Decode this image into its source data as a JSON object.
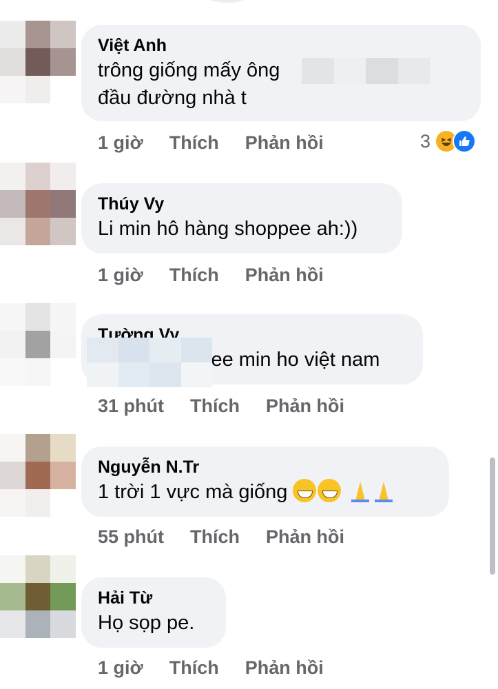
{
  "comments": [
    {
      "author": "Việt Anh",
      "text_lines": [
        "trông giống mấy ông",
        "đầu đường nhà t"
      ],
      "time": "1 giờ",
      "like_label": "Thích",
      "reply_label": "Phản hồi",
      "reaction_count": "3",
      "reaction_icons": [
        "haha-icon",
        "like-icon"
      ]
    },
    {
      "author": "Thúy Vy",
      "text_lines": [
        "Li min hô hàng shoppee ah:))"
      ],
      "time": "1 giờ",
      "like_label": "Thích",
      "reply_label": "Phản hồi"
    },
    {
      "author": "Tường Vy",
      "text_lines": [
        "lee min ho việt nam"
      ],
      "time": "31 phút",
      "like_label": "Thích",
      "reply_label": "Phản hồi"
    },
    {
      "author": "Nguyễn N.Tr",
      "text_lines": [
        "1 trời 1 vực mà giống"
      ],
      "emoji": [
        "😅",
        "😅",
        "🙏",
        "🙏"
      ],
      "time": "55 phút",
      "like_label": "Thích",
      "reply_label": "Phản hồi"
    },
    {
      "author": "Hải Từ",
      "text_lines": [
        "Họ sọp pe."
      ],
      "time": "1 giờ",
      "like_label": "Thích",
      "reply_label": "Phản hồi"
    }
  ],
  "colors": {
    "bubble": "#f0f2f5",
    "meta_text": "#65676b",
    "like_blue": "#1877f2",
    "haha_yellow": "#f7b125"
  }
}
